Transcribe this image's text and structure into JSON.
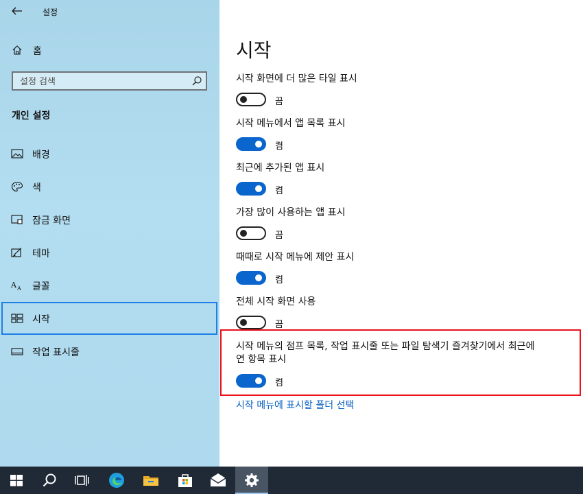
{
  "window": {
    "title": "설정",
    "back_label": "←"
  },
  "sidebar": {
    "home_label": "홈",
    "search_placeholder": "설정 검색",
    "section_title": "개인 설정",
    "items": [
      {
        "label": "배경",
        "icon": "picture-icon"
      },
      {
        "label": "색",
        "icon": "palette-icon"
      },
      {
        "label": "잠금 화면",
        "icon": "lock-screen-icon"
      },
      {
        "label": "테마",
        "icon": "theme-icon"
      },
      {
        "label": "글꼴",
        "icon": "font-icon"
      },
      {
        "label": "시작",
        "icon": "start-icon",
        "selected": true
      },
      {
        "label": "작업 표시줄",
        "icon": "taskbar-icon"
      }
    ]
  },
  "main": {
    "title": "시작",
    "settings": [
      {
        "label": "시작 화면에 더 많은 타일 표시",
        "on": false,
        "state": "끔"
      },
      {
        "label": "시작 메뉴에서 앱 목록 표시",
        "on": true,
        "state": "켬"
      },
      {
        "label": "최근에 추가된 앱 표시",
        "on": true,
        "state": "켬"
      },
      {
        "label": "가장 많이 사용하는 앱 표시",
        "on": false,
        "state": "끔"
      },
      {
        "label": "때때로 시작 메뉴에 제안 표시",
        "on": true,
        "state": "켬"
      },
      {
        "label": "전체 시작 화면 사용",
        "on": false,
        "state": "끔"
      },
      {
        "label": "시작 메뉴의 점프 목록, 작업 표시줄 또는 파일 탐색기 즐겨찾기에서 최근에 연 항목 표시",
        "on": true,
        "state": "켬"
      }
    ],
    "folder_link": "시작 메뉴에 표시할 폴더 선택"
  },
  "colors": {
    "accent": "#0a66cc",
    "highlight": "#ea0f18",
    "sidebar_bg": "#aed9ee",
    "taskbar_bg": "#202a36"
  },
  "taskbar": {
    "items": [
      {
        "icon": "windows-start-icon"
      },
      {
        "icon": "search-icon"
      },
      {
        "icon": "task-view-icon"
      },
      {
        "icon": "edge-icon"
      },
      {
        "icon": "file-explorer-icon"
      },
      {
        "icon": "store-icon"
      },
      {
        "icon": "mail-icon"
      },
      {
        "icon": "settings-gear-icon",
        "active": true
      }
    ]
  }
}
